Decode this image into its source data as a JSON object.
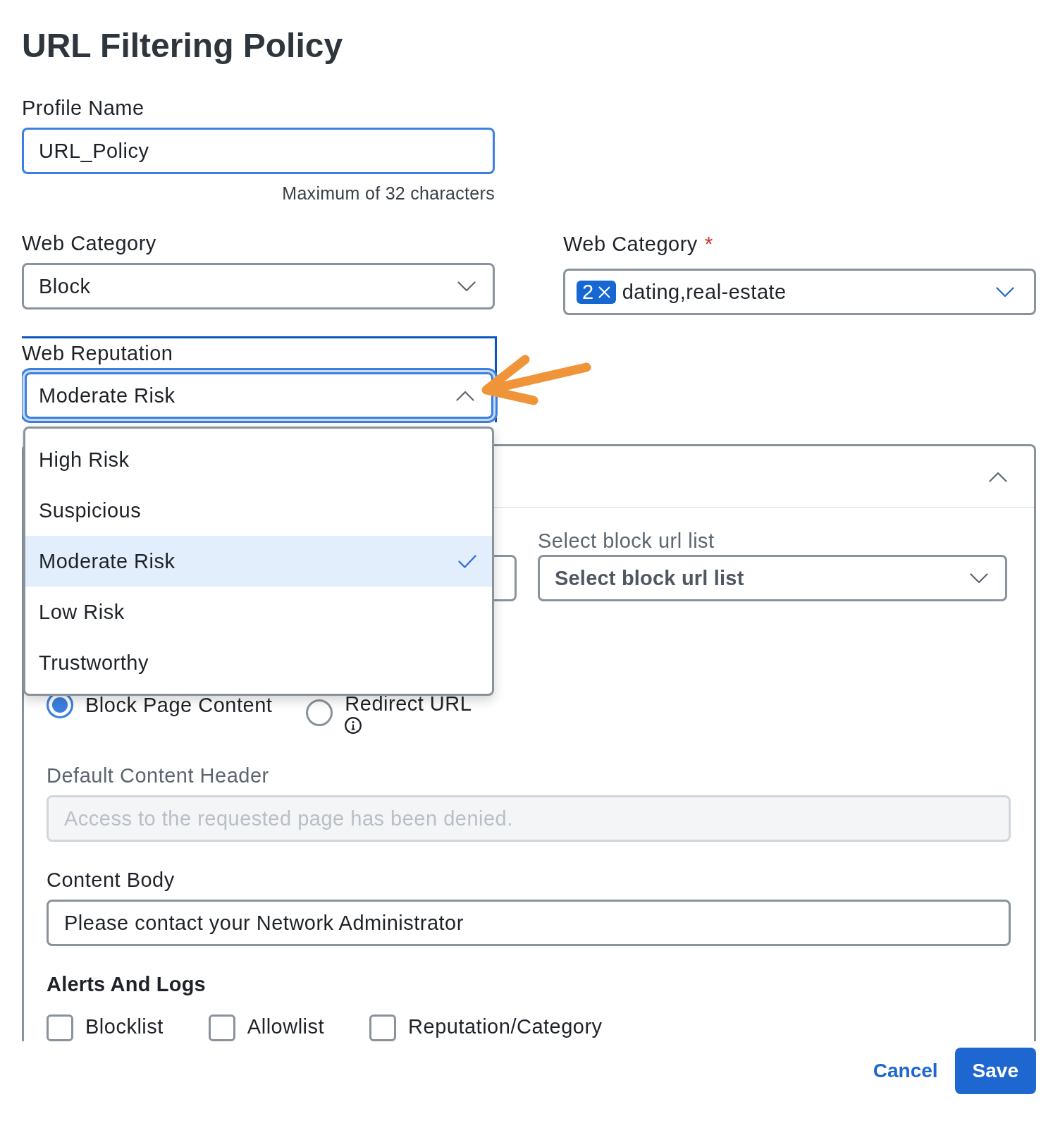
{
  "title": "URL Filtering Policy",
  "profile_name": {
    "label": "Profile Name",
    "value": "URL_Policy",
    "highlighted": true,
    "hint": "Maximum of 32 characters"
  },
  "web_category_action": {
    "label": "Web Category",
    "value": "Block"
  },
  "web_category": {
    "label": "Web Category",
    "required_mark": "*",
    "count": "2",
    "value": "dating,real-estate"
  },
  "web_reputation": {
    "label": "Web Reputation",
    "value": "Moderate Risk",
    "expanded": true,
    "options": [
      {
        "label": "High Risk",
        "selected": false
      },
      {
        "label": "Suspicious",
        "selected": false
      },
      {
        "label": "Moderate Risk",
        "selected": true
      },
      {
        "label": "Low Risk",
        "selected": false
      },
      {
        "label": "Trustworthy",
        "selected": false
      }
    ]
  },
  "panel": {
    "expanded": true,
    "block_list": {
      "label": "Select block url list",
      "placeholder": "Select block url list"
    },
    "response_types": [
      {
        "label": "Block Page Content",
        "selected": true,
        "has_info": false
      },
      {
        "label": "Redirect URL",
        "selected": false,
        "has_info": true
      }
    ],
    "default_content_header": {
      "label": "Default Content Header",
      "placeholder": "Access to the requested page has been denied.",
      "disabled": true
    },
    "content_body": {
      "label": "Content Body",
      "value": "Please contact your Network Administrator"
    },
    "alerts_and_logs": {
      "title": "Alerts And Logs",
      "options": [
        {
          "label": "Blocklist",
          "checked": false
        },
        {
          "label": "Allowlist",
          "checked": false
        },
        {
          "label": "Reputation/Category",
          "checked": false
        }
      ]
    }
  },
  "buttons": [
    {
      "kind": "link",
      "label": "Cancel"
    },
    {
      "kind": "primary",
      "label": "Save"
    }
  ]
}
